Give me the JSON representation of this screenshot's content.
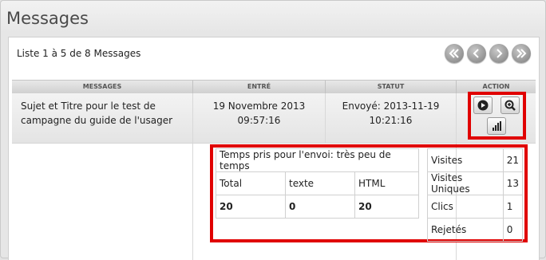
{
  "page": {
    "title": "Messages"
  },
  "list": {
    "info": "Liste 1 à 5 de 8 Messages"
  },
  "pager": [
    "first-page-icon",
    "prev-page-icon",
    "next-page-icon",
    "last-page-icon"
  ],
  "table": {
    "headers": {
      "messages": "MESSAGES",
      "entre": "ENTRÉ",
      "statut": "STATUT",
      "action": "ACTION"
    },
    "row": {
      "subject_line1": "Sujet et Titre pour le test de",
      "subject_line2": "campagne du guide de l'usager",
      "entre_date": "19 Novembre 2013",
      "entre_time": "09:57:16",
      "statut_date": "Envoyé: 2013-11-19",
      "statut_time": "10:21:16"
    }
  },
  "details": {
    "send_time": "Temps pris pour l'envoi: très peu de temps",
    "cols": [
      "Total",
      "texte",
      "HTML"
    ],
    "vals": [
      "20",
      "0",
      "20"
    ],
    "metrics": [
      {
        "label": "Visites",
        "value": "21"
      },
      {
        "label": "Visites Uniques",
        "value": "13"
      },
      {
        "label": "Clics",
        "value": "1"
      },
      {
        "label": "Rejetés",
        "value": "0"
      }
    ]
  },
  "colors": {
    "highlight": "#e00000",
    "header_bg": "#d0d0d0"
  }
}
